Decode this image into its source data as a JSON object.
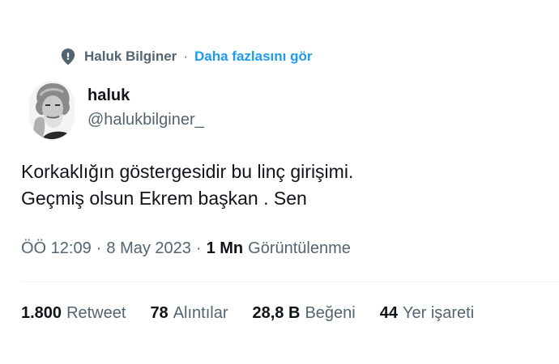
{
  "context": {
    "name": "Haluk Bilginer",
    "separator": "·",
    "more_link": "Daha fazlasını gör"
  },
  "author": {
    "display_name": "haluk",
    "handle": "@halukbilginer_"
  },
  "tweet": {
    "line1": "Korkaklığın göstergesidir bu linç girişimi.",
    "line2": "Geçmiş olsun Ekrem başkan . Sen"
  },
  "meta": {
    "time": "ÖÖ 12:09",
    "sep1": "·",
    "date": "8 May 2023",
    "sep2": "·",
    "views_count": "1 Mn",
    "views_label": "Görüntülenme"
  },
  "stats": [
    {
      "count": "1.800",
      "label": "Retweet"
    },
    {
      "count": "78",
      "label": "Alıntılar"
    },
    {
      "count": "28,8 B",
      "label": "Beğeni"
    },
    {
      "count": "44",
      "label": "Yer işareti"
    }
  ],
  "colors": {
    "text_primary": "#0f1419",
    "text_secondary": "#536471",
    "link": "#1d9bf0",
    "divider": "#eff3f4"
  }
}
